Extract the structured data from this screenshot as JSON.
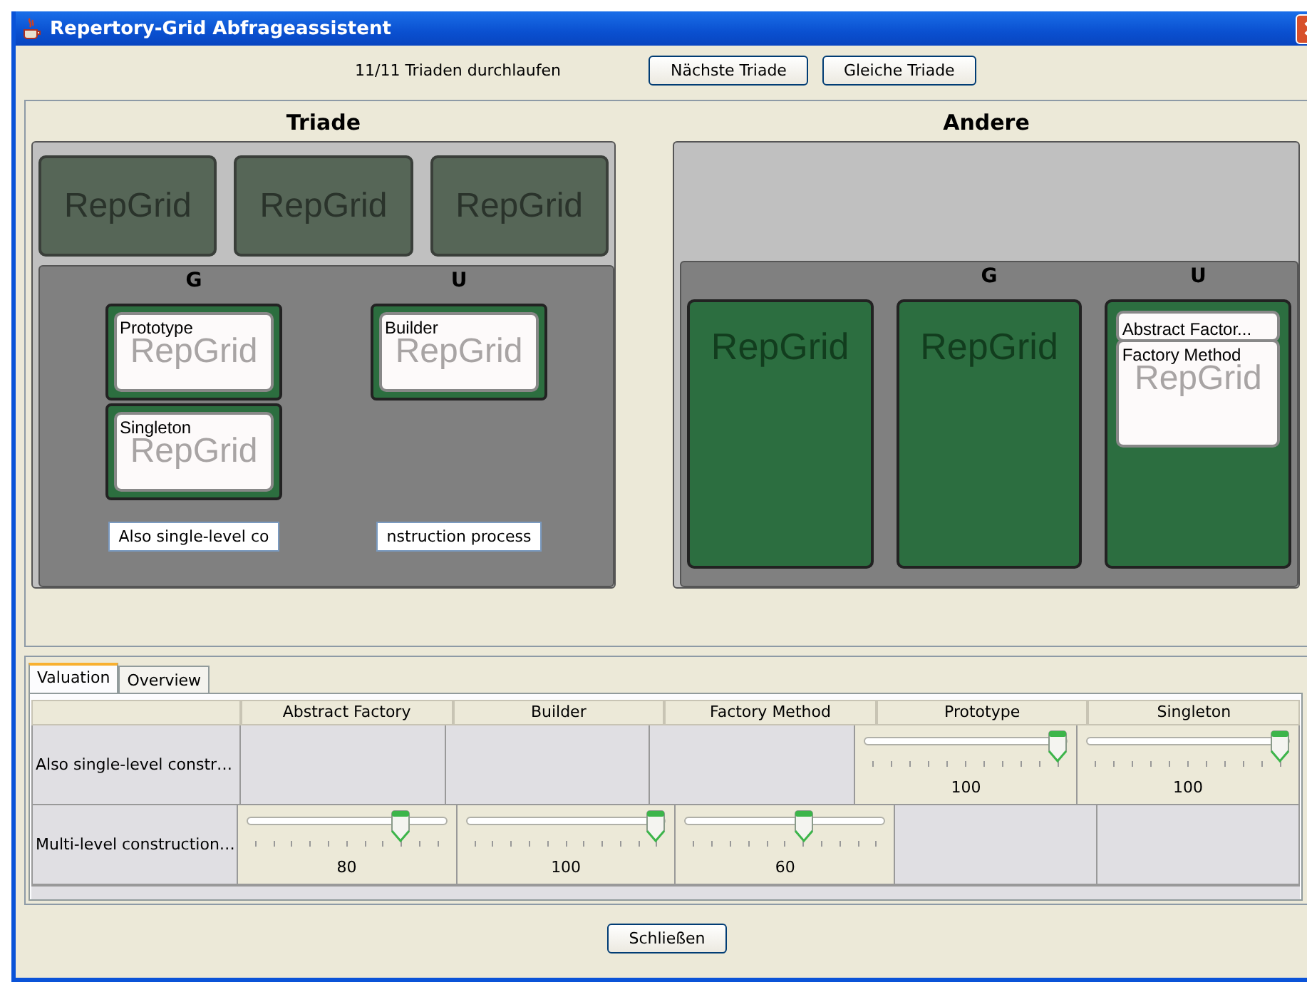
{
  "window": {
    "title": "Repertory-Grid Abfrageassistent"
  },
  "status": "11/11 Triaden durchlaufen",
  "buttons": [
    "Nächste Triade",
    "Gleiche Triade"
  ],
  "triade": {
    "title": "Triade",
    "slots": [
      {
        "kind": "empty",
        "watermark": "RepGrid"
      },
      {
        "kind": "empty",
        "watermark": "RepGrid"
      },
      {
        "kind": "empty",
        "watermark": "RepGrid"
      }
    ],
    "groups": [
      {
        "label": "G",
        "cards": [
          {
            "label": "Prototype",
            "watermark": "RepGrid"
          },
          {
            "label": "Singleton",
            "watermark": "RepGrid"
          }
        ],
        "note": "Also single-level co"
      },
      {
        "label": "U",
        "cards": [
          {
            "label": "Builder",
            "watermark": "RepGrid"
          }
        ],
        "note": "nstruction process"
      }
    ]
  },
  "andere": {
    "title": "Andere",
    "columns": [
      {
        "watermark": "RepGrid"
      },
      {
        "label": "G",
        "watermark": "RepGrid"
      },
      {
        "label": "U",
        "cards": [
          {
            "label": "Abstract Factor..."
          },
          {
            "label": "Factory Method",
            "watermark": "RepGrid"
          }
        ]
      }
    ]
  },
  "tabs": [
    {
      "label": "Valuation",
      "selected": true
    },
    {
      "label": "Overview",
      "selected": false
    }
  ],
  "table": {
    "columns": [
      "Abstract Factory",
      "Builder",
      "Factory Method",
      "Prototype",
      "Singleton"
    ],
    "rows": [
      {
        "label": "Also single-level constr…",
        "cells": [
          {
            "kind": "empty"
          },
          {
            "kind": "empty"
          },
          {
            "kind": "empty"
          },
          {
            "kind": "slider",
            "level": 1,
            "reading": "100"
          },
          {
            "kind": "slider",
            "level": 1,
            "reading": "100"
          }
        ]
      },
      {
        "label": "Multi-level construction…",
        "cells": [
          {
            "kind": "slider",
            "level": 0.8,
            "reading": "80"
          },
          {
            "kind": "slider",
            "level": 1,
            "reading": "100"
          },
          {
            "kind": "slider",
            "level": 0.6,
            "reading": "60"
          },
          {
            "kind": "empty"
          },
          {
            "kind": "empty"
          }
        ]
      }
    ]
  },
  "close_button": "Schließen"
}
